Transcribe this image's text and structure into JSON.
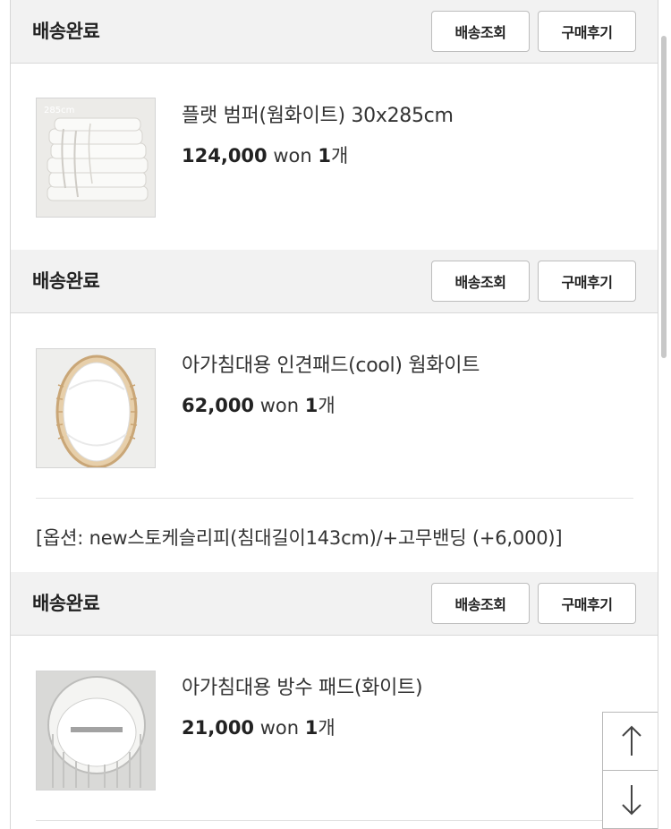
{
  "orders": [
    {
      "status": "배송완료",
      "track_label": "배송조회",
      "review_label": "구매후기",
      "product_name": "플랫 범퍼(웜화이트) 30x285cm",
      "price": "124,000",
      "currency": "won",
      "qty_num": "1",
      "qty_unit": "개",
      "thumb_label": "285cm"
    },
    {
      "status": "배송완료",
      "track_label": "배송조회",
      "review_label": "구매후기",
      "product_name": "아가침대용 인견패드(cool) 웜화이트",
      "price": "62,000",
      "currency": "won",
      "qty_num": "1",
      "qty_unit": "개",
      "option": "[옵션: new스토케슬리피(침대길이143cm)/+고무밴딩 (+6,000)]"
    },
    {
      "status": "배송완료",
      "track_label": "배송조회",
      "review_label": "구매후기",
      "product_name": "아가침대용 방수 패드(화이트)",
      "price": "21,000",
      "currency": "won",
      "qty_num": "1",
      "qty_unit": "개"
    }
  ],
  "float_nav": {
    "up_icon": "arrow-up-icon",
    "down_icon": "arrow-down-icon"
  }
}
